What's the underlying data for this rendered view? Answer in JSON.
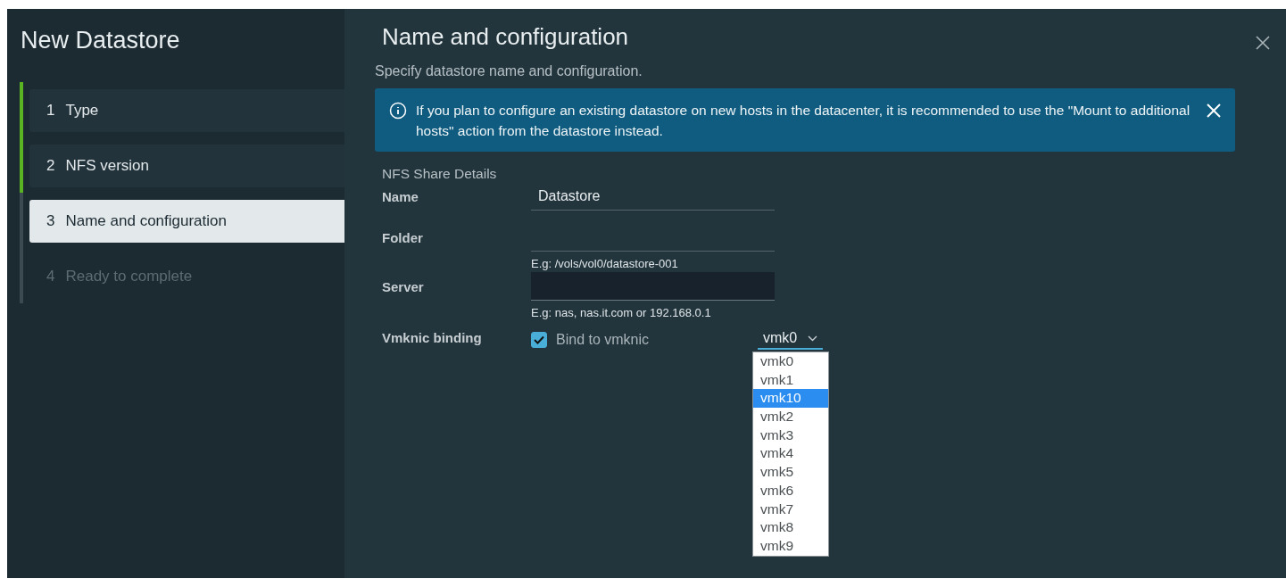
{
  "wizard": {
    "title": "New Datastore",
    "steps": [
      {
        "number": "1",
        "label": "Type",
        "completed": true,
        "selected": false,
        "disabled": false
      },
      {
        "number": "2",
        "label": "NFS version",
        "completed": true,
        "selected": false,
        "disabled": false
      },
      {
        "number": "3",
        "label": "Name and configuration",
        "completed": false,
        "selected": true,
        "disabled": false
      },
      {
        "number": "4",
        "label": "Ready to complete",
        "completed": false,
        "selected": false,
        "disabled": true
      }
    ]
  },
  "page": {
    "title": "Name and configuration",
    "subtitle": "Specify datastore name and configuration.",
    "alert": {
      "text": "If you plan to configure an existing datastore on new hosts in the datacenter, it is recommended to use the \"Mount to additional hosts\" action from the datastore instead."
    },
    "section": "NFS Share Details",
    "fields": [
      {
        "label": "Name",
        "value": "Datastore"
      },
      {
        "label": "Folder",
        "helper": "E.g: /vols/vol0/datastore-001"
      },
      {
        "label": "Server",
        "helper": "E.g: nas, nas.it.com or 192.168.0.1",
        "focused": true
      }
    ],
    "binding": {
      "label": "Vmknic binding",
      "checkbox": {
        "label": "Bind to vmknic",
        "checked": true
      },
      "select": {
        "value": "vmk0",
        "expanded": true,
        "options": [
          {
            "label": "vmk0",
            "highlighted": false
          },
          {
            "label": "vmk1",
            "highlighted": false
          },
          {
            "label": "vmk10",
            "highlighted": true
          },
          {
            "label": "vmk2",
            "highlighted": false
          },
          {
            "label": "vmk3",
            "highlighted": false
          },
          {
            "label": "vmk4",
            "highlighted": false
          },
          {
            "label": "vmk5",
            "highlighted": false
          },
          {
            "label": "vmk6",
            "highlighted": false
          },
          {
            "label": "vmk7",
            "highlighted": false
          },
          {
            "label": "vmk8",
            "highlighted": false
          },
          {
            "label": "vmk9",
            "highlighted": false
          }
        ]
      }
    }
  }
}
